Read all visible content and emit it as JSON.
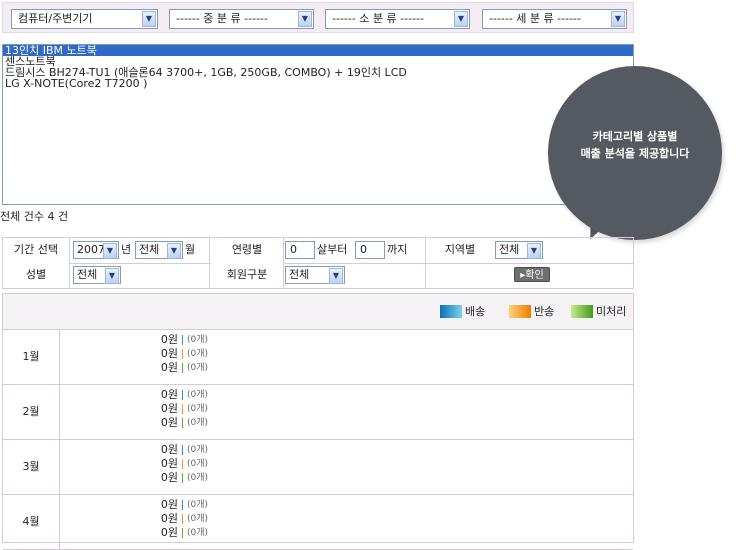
{
  "categories": {
    "main": "컴퓨터/주변기기",
    "middle": "------ 중 분 류 ------",
    "small": "------ 소 분 류 ------",
    "detail": "------ 세 분 류 ------"
  },
  "products": [
    "13인치 IBM 노트북",
    "센스노트북",
    "드림시스 BH274-TU1 (애슬론64 3700+, 1GB, 250GB, COMBO) + 19인치 LCD",
    "LG X-NOTE(Core2 T7200 )"
  ],
  "total_count": "전체 건수 4 건",
  "tooltip": {
    "line1": "카테고리별 상품별",
    "line2": "매출 분석을 제공합니다"
  },
  "filter": {
    "period_label": "기간 선택",
    "year": "2007",
    "year_unit": "년",
    "month": "전체",
    "month_unit": "월",
    "age_label": "연령별",
    "age_from": "0",
    "age_from_unit": "살부터",
    "age_to": "0",
    "age_to_unit": "까지",
    "region_label": "지역별",
    "region": "전체",
    "gender_label": "성별",
    "gender": "전체",
    "member_label": "회원구분",
    "member": "전체",
    "confirm": "▸확인"
  },
  "legend": [
    {
      "label": "배송",
      "color_from": "#0a6fb5",
      "color_to": "#7fd0f0"
    },
    {
      "label": "반송",
      "color_from": "#ffd27a",
      "color_to": "#f07c00"
    },
    {
      "label": "미처리",
      "color_from": "#c9ea8a",
      "color_to": "#3f9b1f"
    }
  ],
  "months": [
    {
      "label": "1월",
      "rows": [
        {
          "value": "0원",
          "count": "(0개)"
        },
        {
          "value": "0원",
          "count": "(0개)"
        },
        {
          "value": "0원",
          "count": "(0개)"
        }
      ]
    },
    {
      "label": "2월",
      "rows": [
        {
          "value": "0원",
          "count": "(0개)"
        },
        {
          "value": "0원",
          "count": "(0개)"
        },
        {
          "value": "0원",
          "count": "(0개)"
        }
      ]
    },
    {
      "label": "3월",
      "rows": [
        {
          "value": "0원",
          "count": "(0개)"
        },
        {
          "value": "0원",
          "count": "(0개)"
        },
        {
          "value": "0원",
          "count": "(0개)"
        }
      ]
    },
    {
      "label": "4월",
      "rows": [
        {
          "value": "0원",
          "count": "(0개)"
        },
        {
          "value": "0원",
          "count": "(0개)"
        },
        {
          "value": "0원",
          "count": "(0개)"
        }
      ]
    }
  ],
  "bar_colors": [
    "#3a8fd0",
    "#f0a020",
    "#5cb030"
  ],
  "icons": {
    "dropdown": "chevron-down-icon"
  }
}
